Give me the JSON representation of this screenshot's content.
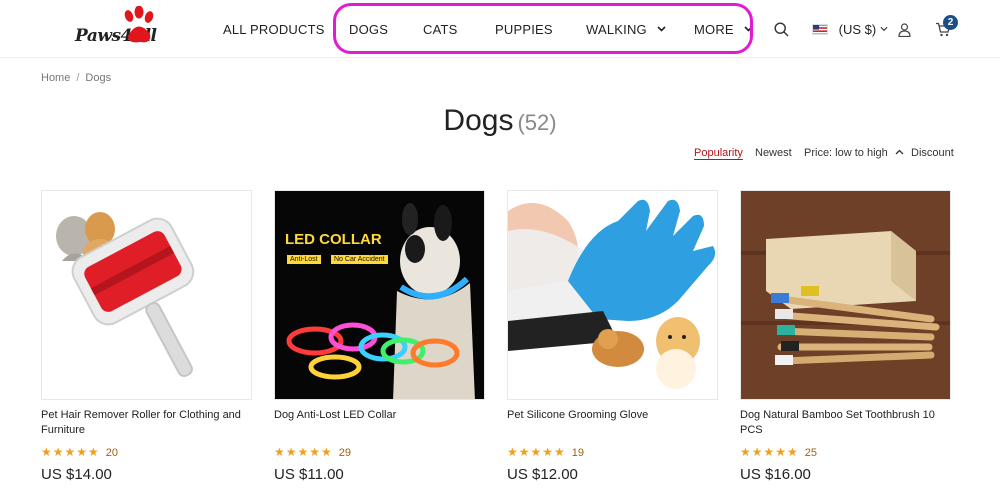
{
  "brand": {
    "logo_text": "Paws4All"
  },
  "nav": {
    "items": [
      {
        "label": "ALL PRODUCTS"
      },
      {
        "label": "DOGS"
      },
      {
        "label": "CATS"
      },
      {
        "label": "PUPPIES"
      },
      {
        "label": "WALKING",
        "has_dropdown": true
      },
      {
        "label": "MORE",
        "has_dropdown": true
      }
    ],
    "highlight_color": "#e21ad1"
  },
  "header": {
    "currency": "(US $)",
    "cart_count": "2",
    "icons": [
      "search-icon",
      "us-flag-icon",
      "account-icon",
      "cart-icon"
    ]
  },
  "breadcrumb": {
    "home": "Home",
    "separator": "/",
    "current": "Dogs"
  },
  "page": {
    "title": "Dogs",
    "count": "(52)"
  },
  "sort": {
    "options": [
      "Popularity",
      "Newest",
      "Price: low to high",
      "Discount"
    ],
    "active": "Popularity",
    "accent_color": "#b1161c"
  },
  "products": [
    {
      "name": "Pet Hair Remover Roller for Clothing and Furniture",
      "stars": "★★★★★",
      "reviews": "20",
      "price": "US $14.00"
    },
    {
      "name": "Dog Anti-Lost LED Collar",
      "stars": "★★★★★",
      "reviews": "29",
      "price": "US $11.00",
      "image_text": "LED COLLAR",
      "image_tags": [
        "Anti-Lost",
        "No Car Accident"
      ]
    },
    {
      "name": "Pet Silicone Grooming Glove",
      "stars": "★★★★★",
      "reviews": "19",
      "price": "US $12.00"
    },
    {
      "name": "Dog Natural Bamboo Set Toothbrush 10 PCS",
      "stars": "★★★★★",
      "reviews": "25",
      "price": "US $16.00"
    }
  ]
}
